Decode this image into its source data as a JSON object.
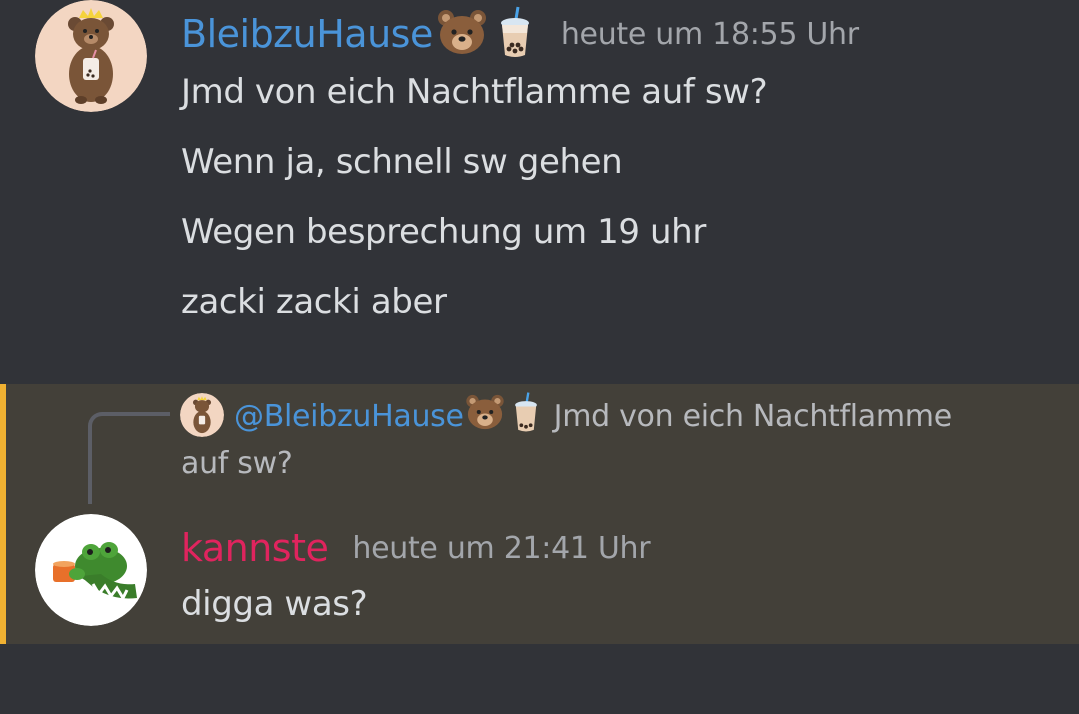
{
  "messages": [
    {
      "username": "BleibzuHause",
      "username_color": "#4a94d9",
      "username_emojis": [
        "bear-emoji",
        "bubble-tea-emoji"
      ],
      "timestamp": "heute um 18:55 Uhr",
      "avatar": "bear-with-crown-and-bubble-tea",
      "lines": [
        "Jmd von eich Nachtflamme auf sw?",
        "Wenn ja, schnell sw gehen",
        "Wegen besprechung um 19 uhr",
        "zacki zacki aber"
      ]
    },
    {
      "highlighted": true,
      "highlight_color": "#f0b132",
      "reply": {
        "mention": "@BleibzuHause",
        "mention_emojis": [
          "bear-emoji",
          "bubble-tea-emoji"
        ],
        "preview_part1": "Jmd von eich Nachtflamme",
        "preview_part2": "auf sw?"
      },
      "username": "kannste",
      "username_color": "#e0245e",
      "timestamp": "heute um 21:41 Uhr",
      "avatar": "kermit-drinking-tea",
      "lines": [
        "digga was?"
      ]
    }
  ]
}
